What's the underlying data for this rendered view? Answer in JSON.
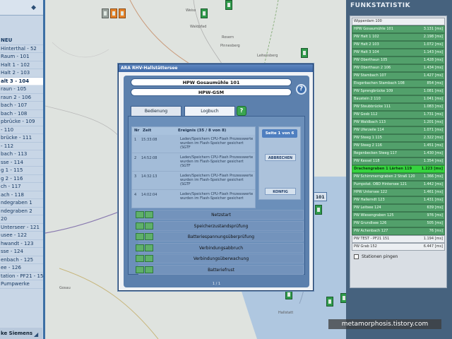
{
  "left_panel": {
    "items": [
      {
        "label": "NEU",
        "style": "bold"
      },
      {
        "label": "Hinterthal - 52",
        "style": ""
      },
      {
        "label": "Raum - 101",
        "style": ""
      },
      {
        "label": "Halt 1 - 102",
        "style": ""
      },
      {
        "label": "Halt 2 - 103",
        "style": ""
      },
      {
        "label": "alt 3 - 104",
        "style": "sel"
      },
      {
        "label": "raun - 105",
        "style": ""
      },
      {
        "label": "raun 2 - 106",
        "style": ""
      },
      {
        "label": "bach - 107",
        "style": ""
      },
      {
        "label": "bach - 108",
        "style": ""
      },
      {
        "label": "pbrücke - 109",
        "style": ""
      },
      {
        "label": "- 110",
        "style": ""
      },
      {
        "label": "brücke - 111",
        "style": ""
      },
      {
        "label": "- 112",
        "style": ""
      },
      {
        "label": "bach - 113",
        "style": ""
      },
      {
        "label": "sse - 114",
        "style": ""
      },
      {
        "label": "g 1 - 115",
        "style": ""
      },
      {
        "label": "g 2 - 116",
        "style": ""
      },
      {
        "label": "ch - 117",
        "style": ""
      },
      {
        "label": "ach - 118",
        "style": ""
      },
      {
        "label": "ndegraben 1",
        "style": ""
      },
      {
        "label": "ndegraben 2",
        "style": ""
      },
      {
        "label": "20",
        "style": ""
      },
      {
        "label": "Unterseer - 121",
        "style": ""
      },
      {
        "label": "usee - 122",
        "style": ""
      },
      {
        "label": "hwandt - 123",
        "style": ""
      },
      {
        "label": "sse - 124",
        "style": ""
      },
      {
        "label": "enbach - 125",
        "style": ""
      },
      {
        "label": "ee - 126",
        "style": ""
      },
      {
        "label": "tation - PF21 - 151",
        "style": ""
      },
      {
        "label": "Pumpwerke",
        "style": ""
      }
    ],
    "footer": "ke Siemens"
  },
  "map": {
    "labels": [
      "Weiss",
      "Waldpfad",
      "Rosern",
      "Pinnesberg",
      "Leitensberg",
      "Gosau",
      "Hallstatt"
    ],
    "tag": "101"
  },
  "dialog": {
    "title": "ARA RHV-Hallstättersee",
    "station_name": "HPW Gosaumühle 101",
    "station_type": "HPW-GSM",
    "help": "?",
    "tabs": [
      {
        "label": "Bedienung"
      },
      {
        "label": "Logbuch"
      }
    ],
    "go": "?",
    "log": {
      "col_nr": "Nr",
      "col_zeit": "Zeit",
      "col_ereignis": "Ereignis (35 / 8 von 8)",
      "rows": [
        {
          "nr": "1",
          "zeit": "15:33:08",
          "text": "Laden/Speichern CPU-Flash Prozesswerte wurden im Flash-Speicher gesichert (SGTF"
        },
        {
          "nr": "2",
          "zeit": "14:52:08",
          "text": "Laden/Speichern CPU-Flash Prozesswerte wurden im Flash-Speicher gesichert (SGTF"
        },
        {
          "nr": "3",
          "zeit": "14:32:13",
          "text": "Laden/Speichern CPU-Flash Prozesswerte wurden im Flash-Speicher gesichert (SGTF"
        },
        {
          "nr": "4",
          "zeit": "14:02:04",
          "text": "Laden/Speichern CPU-Flash Prozesswerte wurden im Flash-Speicher gesichert"
        }
      ]
    },
    "pager": {
      "label": "Seite 1 von 6",
      "btn1": "ABBRECHEN",
      "btn2": "KONFIG"
    },
    "options": [
      {
        "label": "Netzstart"
      },
      {
        "label": "Speicherzustandsprüfung"
      },
      {
        "label": "Batteriespannungsüberprüfung"
      },
      {
        "label": "Verbindungsabbruch"
      },
      {
        "label": "Verbindungsüberwachung"
      },
      {
        "label": "Batteriefrust"
      }
    ],
    "footer": "1 / 1"
  },
  "stats": {
    "title": "FUNKSTATISTIK",
    "rows": [
      {
        "name": "Wipperdam 100",
        "value": "",
        "style": "grey"
      },
      {
        "name": "HPW Gosaumühle 101",
        "value": "3.131 [ms]",
        "style": ""
      },
      {
        "name": "PW Halt 1 102",
        "value": "2.198 [ms]",
        "style": ""
      },
      {
        "name": "PW Halt 2 103",
        "value": "1.072 [ms]",
        "style": ""
      },
      {
        "name": "PW Halt 3 104",
        "value": "1.143 [ms]",
        "style": ""
      },
      {
        "name": "PW Oberthaun 105",
        "value": "1.428 [ms]",
        "style": ""
      },
      {
        "name": "PW Oberthaun 2 106",
        "value": "1.434 [ms]",
        "style": ""
      },
      {
        "name": "PW Stambach 107",
        "value": "1.427 [ms]",
        "style": ""
      },
      {
        "name": "Eisgerbachen Stambach 108",
        "value": "854 [ms]",
        "style": ""
      },
      {
        "name": "PW Sprengbrücke 109",
        "value": "1.081 [ms]",
        "style": ""
      },
      {
        "name": "Baustein 2 110",
        "value": "1.041 [ms]",
        "style": ""
      },
      {
        "name": "PW Steubbrücke 111",
        "value": "1.083 [ms]",
        "style": ""
      },
      {
        "name": "PW Gosb 112",
        "value": "1.731 [ms]",
        "style": ""
      },
      {
        "name": "PW Waldbach 113",
        "value": "1.201 [ms]",
        "style": ""
      },
      {
        "name": "PW Uferzeile 114",
        "value": "1.071 [ms]",
        "style": ""
      },
      {
        "name": "PW Steeg 1 115",
        "value": "2.322 [ms]",
        "style": ""
      },
      {
        "name": "PW Steeg 2 116",
        "value": "1.451 [ms]",
        "style": ""
      },
      {
        "name": "Regenbecken Steeg 117",
        "value": "1.430 [ms]",
        "style": ""
      },
      {
        "name": "PW Kessel 118",
        "value": "1.354 [ms]",
        "style": ""
      },
      {
        "name": "Drachengraben 1 Lärhen 119",
        "value": "1.223 [ms]",
        "style": "hi"
      },
      {
        "name": "PW Schimmerngraben 2 Straß 120",
        "value": "1.366 [ms]",
        "style": ""
      },
      {
        "name": "Pumpstat. OBD Hintersee 121",
        "value": "1.442 [ms]",
        "style": ""
      },
      {
        "name": "HPW Untersee 122",
        "value": "1.461 [ms]",
        "style": ""
      },
      {
        "name": "PW Hallerndt 123",
        "value": "1.431 [ms]",
        "style": ""
      },
      {
        "name": "PW Leitsee 124",
        "value": "639 [ms]",
        "style": ""
      },
      {
        "name": "PW Wiesengraben 125",
        "value": "976 [ms]",
        "style": ""
      },
      {
        "name": "PW Grundlsee 126",
        "value": "505 [ms]",
        "style": ""
      },
      {
        "name": "PW Achenbach 127",
        "value": "76 [ms]",
        "style": ""
      },
      {
        "name": "PW TEST - PF21 151",
        "value": "1.194 [ms]",
        "style": "grey"
      },
      {
        "name": "PW Grab 152",
        "value": "6.447 [ms]",
        "style": "grey"
      }
    ],
    "checkbox_label": "Stationen pingen"
  },
  "watermark": "metamorphosis.tistory.com"
}
